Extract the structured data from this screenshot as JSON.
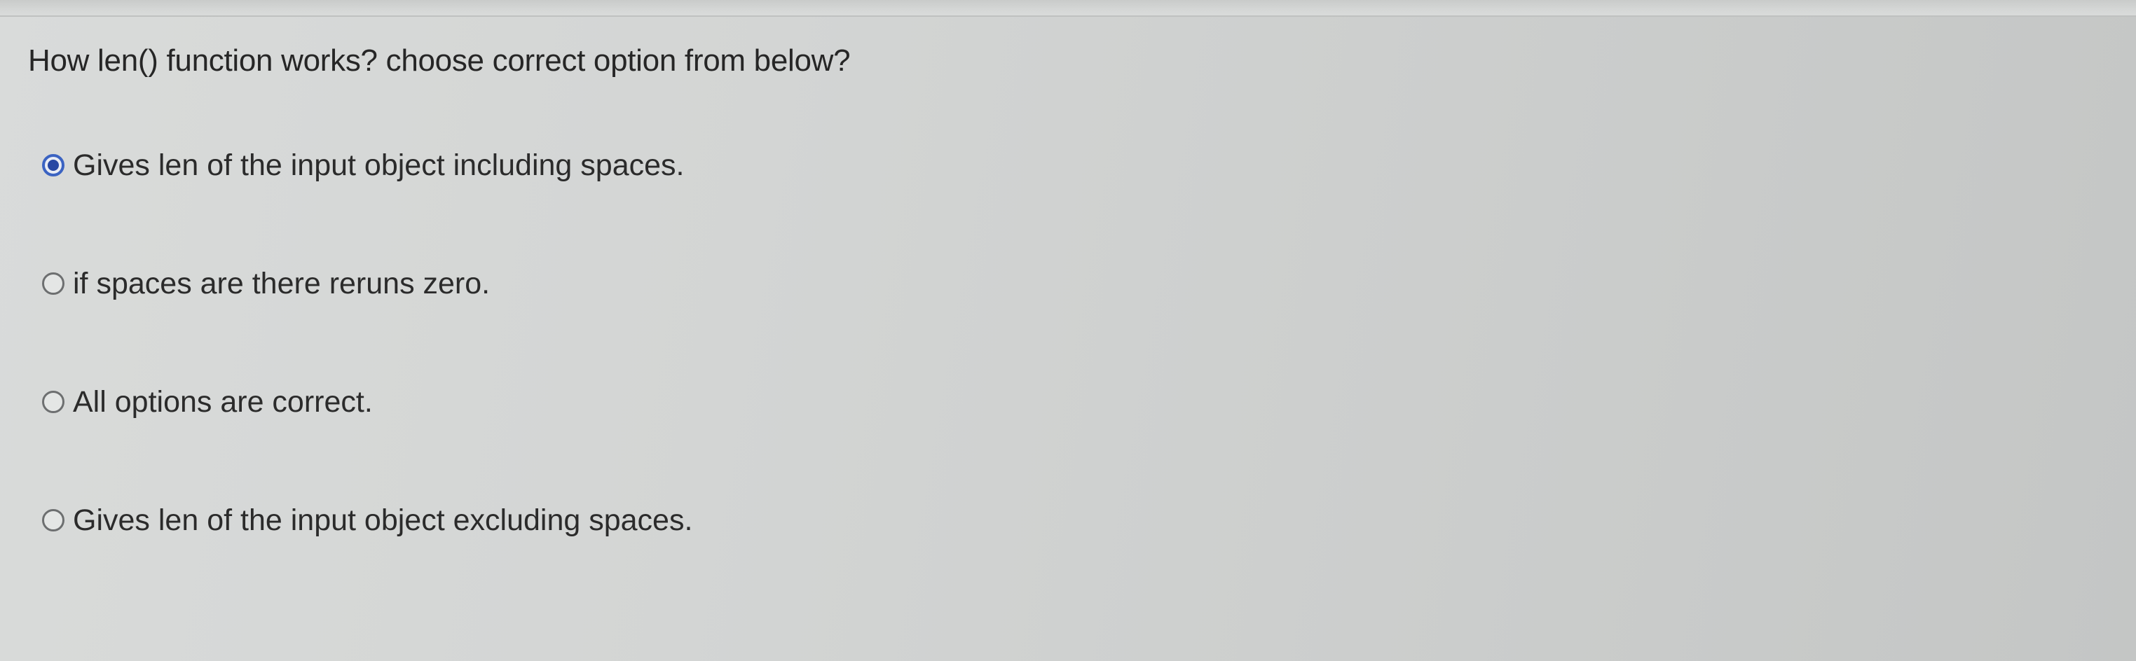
{
  "question": {
    "text": "How len() function works? choose correct option from below?"
  },
  "options": [
    {
      "label": "Gives len of the input object including spaces.",
      "selected": true
    },
    {
      "label": "if spaces are there reruns zero.",
      "selected": false
    },
    {
      "label": "All options are correct.",
      "selected": false
    },
    {
      "label": "Gives len of the input object excluding spaces.",
      "selected": false
    }
  ],
  "colors": {
    "selected_radio": "#2747a3",
    "text": "#262626",
    "background": "#d3d5d4"
  }
}
